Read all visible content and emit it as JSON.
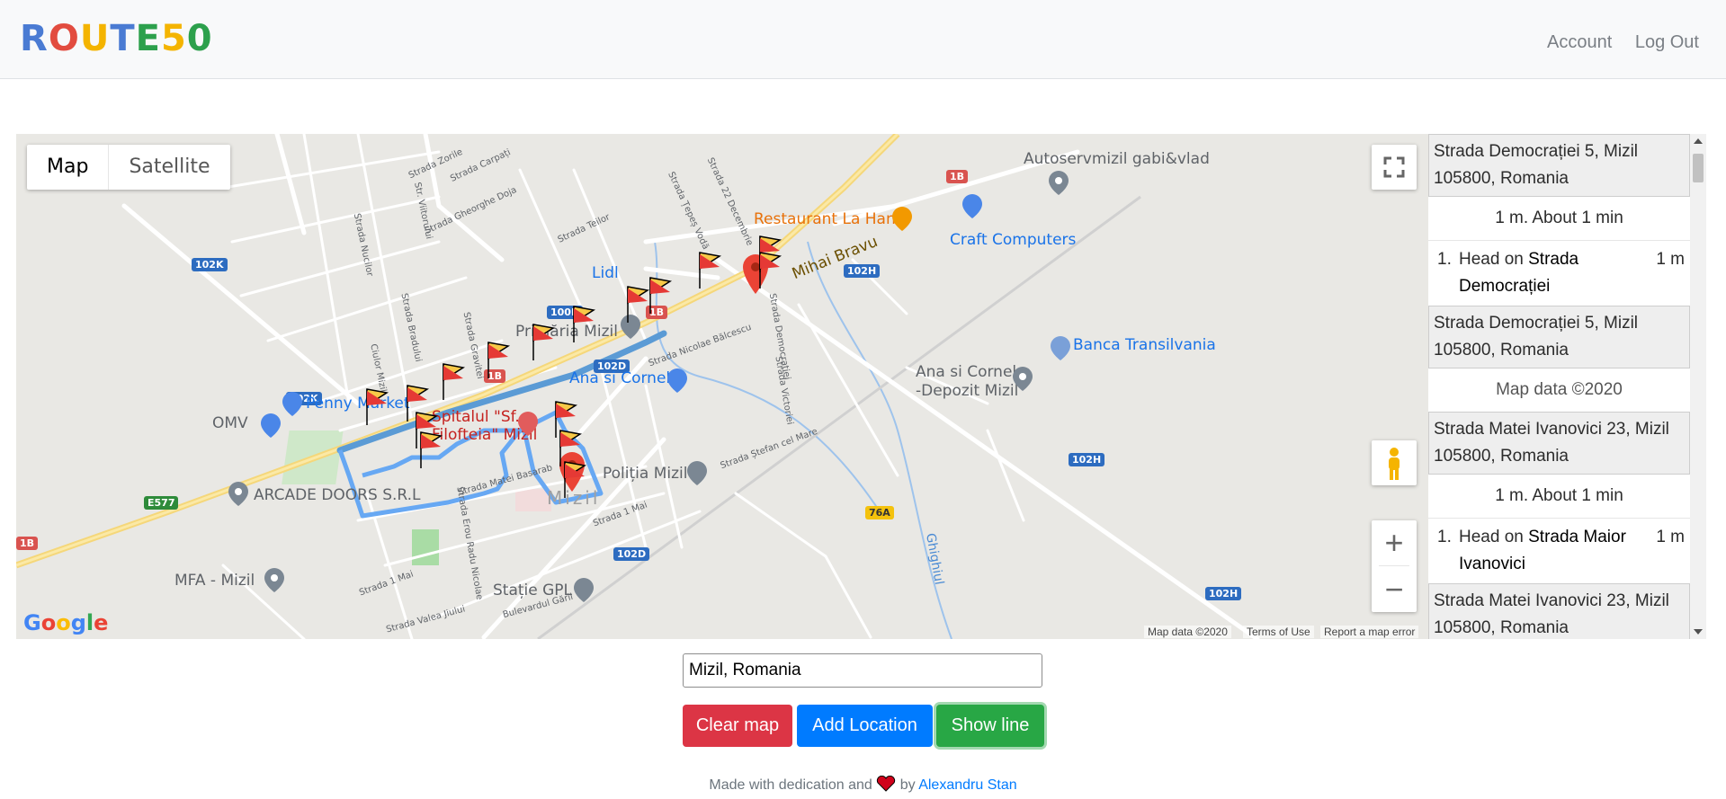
{
  "navbar": {
    "brand_letters": [
      {
        "ch": "R",
        "color": "#4a7bd3"
      },
      {
        "ch": "O",
        "color": "#e24c3f"
      },
      {
        "ch": "U",
        "color": "#f4b400"
      },
      {
        "ch": "T",
        "color": "#4a7bd3"
      },
      {
        "ch": "E",
        "color": "#2ca04c"
      },
      {
        "ch": "5",
        "color": "#f4b400"
      },
      {
        "ch": "0",
        "color": "#2ca04c"
      }
    ],
    "account_label": "Account",
    "logout_label": "Log Out"
  },
  "map": {
    "type_map_label": "Map",
    "type_satellite_label": "Satellite",
    "labels": {
      "autoservmizil": "Autoservmizil gabi&vlad",
      "restaurant": "Restaurant La Han",
      "craft": "Craft Computers",
      "mihai": "Mihai Bravu",
      "lidl": "Lidl",
      "primaria": "Primăria Mizil",
      "banca": "Banca Transilvania",
      "ana_cornel": "Ana si Cornel",
      "ana_depozit_1": "Ana si Cornel",
      "ana_depozit_2": "-Depozit Mizil",
      "penny": "Penny Market",
      "omv": "OMV",
      "spitalul_1": "Spitalul \"Sf.",
      "spitalul_2": "Filofteia\" Mizil",
      "politia": "Poliția Mizil",
      "arcade": "ARCADE DOORS S.R.L",
      "mizil": "Mizil",
      "mfa": "MFA - Mizil",
      "statie": "Stație GPL",
      "ghighiul": "Ghighiul",
      "str_democratiei": "Strada Democrației",
      "str_victoriei": "Strada Victoriei",
      "str_nicolae": "Strada Nicolae Bălcescu",
      "str_matei": "Strada Matei Basarab",
      "str_stefan": "Strada Ștefan cel Mare",
      "str_1mai": "Strada 1 Mai",
      "str_erou": "Strada Erou Radu Nicolae",
      "str_zorile": "Strada Zorile",
      "str_carpati": "Strada Carpați",
      "str_gheorghe": "Strada Gheorghe Doja",
      "str_teilor": "Strada Teilor",
      "str_tepes": "Strada Țepeș Vodă",
      "str_22dec": "Strada 22 Decembrie",
      "str_bradului": "Strada Bradului",
      "str_garii": "Bulevardul Gării",
      "str_valea": "Strada Valea Jiului",
      "str_nucilor": "Strada Nucilor",
      "str_viitorului": "Str. Viitorului",
      "str_gravitei": "Strada Gravitei",
      "str_ciulor": "Ciulor Mizil",
      "str_1mai_b": "Strada 1 Mai"
    },
    "badges": {
      "b102k_1": "102K",
      "b102k_2": "102K",
      "b102h_1": "102H",
      "b102h_2": "102H",
      "b102h_3": "102H",
      "b102d_1": "102D",
      "b102d_2": "102D",
      "b100h": "100H",
      "b1b_1": "1B",
      "b1b_2": "1B",
      "b1b_3": "1B",
      "b1b_4": "1B",
      "be577": "E577",
      "b76a": "76A"
    },
    "google": [
      {
        "ch": "G",
        "color": "#4285f4"
      },
      {
        "ch": "o",
        "color": "#ea4335"
      },
      {
        "ch": "o",
        "color": "#fbbc05"
      },
      {
        "ch": "g",
        "color": "#4285f4"
      },
      {
        "ch": "l",
        "color": "#34a853"
      },
      {
        "ch": "e",
        "color": "#ea4335"
      }
    ],
    "attribution_data": "Map data ©2020",
    "attribution_terms": "Terms of Use",
    "attribution_report": "Report a map error"
  },
  "directions": {
    "legs": [
      {
        "start": "Strada Democrației 5, Mizil 105800, Romania",
        "summary": "1 m. About 1 min",
        "steps": [
          {
            "num": "1.",
            "pre": "Head on ",
            "street": "Strada Democrației",
            "dist": "1 m"
          }
        ],
        "end": "Strada Democrației 5, Mizil 105800, Romania"
      },
      {
        "start": "Strada Matei Ivanovici 23, Mizil 105800, Romania",
        "summary": "1 m. About 1 min",
        "steps": [
          {
            "num": "1.",
            "pre": "Head on ",
            "street": "Strada Maior Ivanovici",
            "dist": "1 m"
          }
        ],
        "end": "Strada Matei Ivanovici 23, Mizil 105800, Romania"
      }
    ],
    "map_data": "Map data ©2020"
  },
  "form": {
    "search_value": "Mizil, Romania",
    "clear_label": "Clear map",
    "add_label": "Add Location",
    "show_label": "Show line"
  },
  "footer": {
    "text_pre": "Made with dedication and",
    "text_by": "by",
    "author": "Alexandru Stan"
  }
}
